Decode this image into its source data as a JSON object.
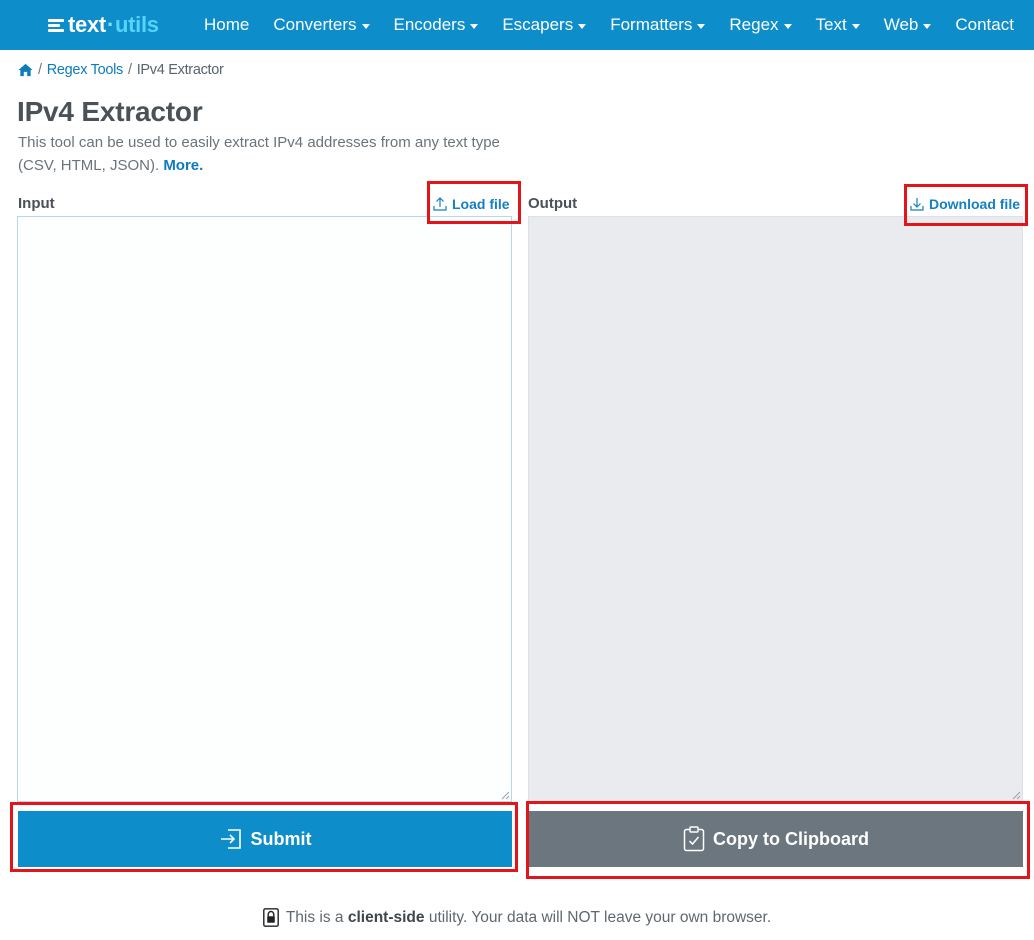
{
  "brand": {
    "text": "text",
    "dot": "·",
    "utils": "utils"
  },
  "nav": [
    {
      "label": "Home",
      "dropdown": false
    },
    {
      "label": "Converters",
      "dropdown": true
    },
    {
      "label": "Encoders",
      "dropdown": true
    },
    {
      "label": "Escapers",
      "dropdown": true
    },
    {
      "label": "Formatters",
      "dropdown": true
    },
    {
      "label": "Regex",
      "dropdown": true
    },
    {
      "label": "Text",
      "dropdown": true
    },
    {
      "label": "Web",
      "dropdown": true
    },
    {
      "label": "Contact",
      "dropdown": false
    }
  ],
  "breadcrumb": {
    "sep": "/",
    "parent": "Regex Tools",
    "current": "IPv4 Extractor"
  },
  "page": {
    "title": "IPv4 Extractor",
    "description": "This tool can be used to easily extract IPv4 addresses from any text type (CSV, HTML, JSON).",
    "more_link": "More."
  },
  "input": {
    "label": "Input",
    "load_file": "Load file",
    "value": ""
  },
  "output": {
    "label": "Output",
    "download_file": "Download file",
    "value": ""
  },
  "buttons": {
    "submit": "Submit",
    "copy": "Copy to Clipboard"
  },
  "footer_note": {
    "before": "This is a",
    "bold": "client-side",
    "after": "utility. Your data will NOT leave your own browser."
  },
  "colors": {
    "primary": "#0d8dca",
    "secondary": "#6c767f",
    "highlight": "#e3151b",
    "link": "#0c7cbd"
  }
}
